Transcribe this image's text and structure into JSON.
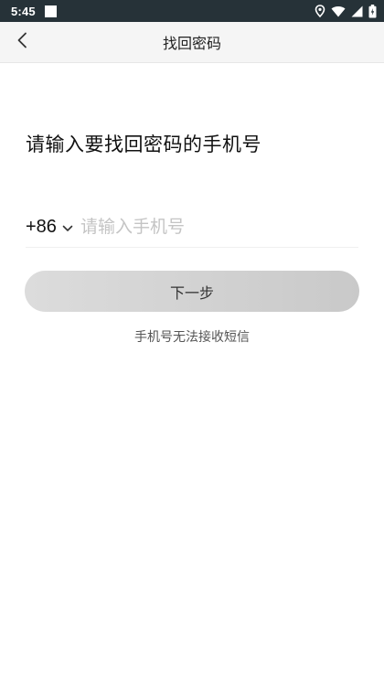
{
  "status_bar": {
    "time": "5:45",
    "icons": [
      "notification-square-icon",
      "location-icon",
      "wifi-icon",
      "signal-icon",
      "battery-icon"
    ]
  },
  "nav": {
    "title": "找回密码",
    "back_icon": "chevron-left-icon"
  },
  "main": {
    "heading": "请输入要找回密码的手机号",
    "country_code": "+86",
    "phone_placeholder": "请输入手机号",
    "phone_value": "",
    "next_button": "下一步",
    "help_link": "手机号无法接收短信"
  },
  "colors": {
    "status_bar": "#263238",
    "nav_bar": "#f5f5f5",
    "button": "#d4d4d4",
    "placeholder": "#c4c4c4"
  }
}
